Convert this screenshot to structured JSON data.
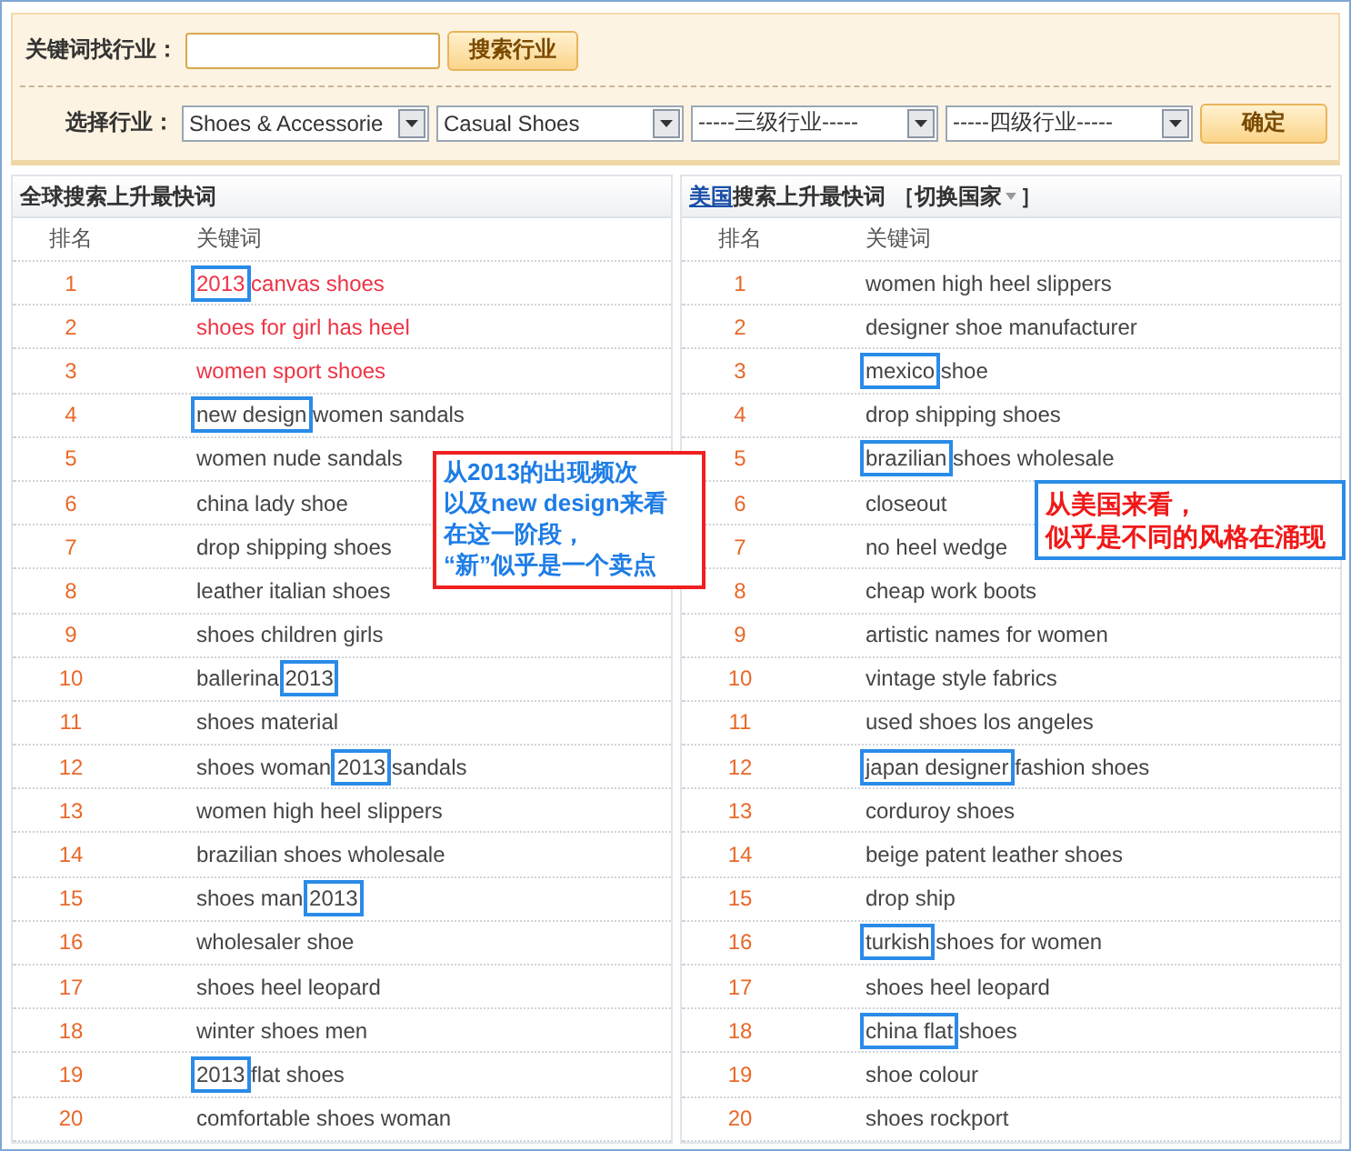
{
  "search": {
    "label": "关键词找行业：",
    "button": "搜索行业"
  },
  "industry": {
    "label": "选择行业：",
    "selects": [
      "Shoes & Accessorie",
      "Casual Shoes",
      "-----三级行业-----",
      "-----四级行业-----"
    ],
    "button": "确定"
  },
  "global_panel": {
    "title": "全球搜索上升最快词",
    "columns": [
      "排名",
      "关键词"
    ],
    "rows": [
      {
        "rank": "1",
        "hot": true,
        "parts": [
          {
            "text": "2013",
            "boxed": true
          },
          {
            "text": " canvas shoes",
            "boxed": false
          }
        ]
      },
      {
        "rank": "2",
        "hot": true,
        "parts": [
          {
            "text": "shoes for girl has heel",
            "boxed": false
          }
        ]
      },
      {
        "rank": "3",
        "hot": true,
        "parts": [
          {
            "text": "women sport shoes",
            "boxed": false
          }
        ]
      },
      {
        "rank": "4",
        "hot": false,
        "parts": [
          {
            "text": "new design",
            "boxed": true
          },
          {
            "text": " women sandals",
            "boxed": false
          }
        ]
      },
      {
        "rank": "5",
        "hot": false,
        "parts": [
          {
            "text": "women nude sandals",
            "boxed": false
          }
        ]
      },
      {
        "rank": "6",
        "hot": false,
        "parts": [
          {
            "text": "china lady shoe",
            "boxed": false
          }
        ]
      },
      {
        "rank": "7",
        "hot": false,
        "parts": [
          {
            "text": "drop shipping shoes",
            "boxed": false
          }
        ]
      },
      {
        "rank": "8",
        "hot": false,
        "parts": [
          {
            "text": "leather italian shoes",
            "boxed": false
          }
        ]
      },
      {
        "rank": "9",
        "hot": false,
        "parts": [
          {
            "text": "shoes children girls",
            "boxed": false
          }
        ]
      },
      {
        "rank": "10",
        "hot": false,
        "parts": [
          {
            "text": "ballerina ",
            "boxed": false
          },
          {
            "text": "2013",
            "boxed": true
          }
        ]
      },
      {
        "rank": "11",
        "hot": false,
        "parts": [
          {
            "text": "shoes material",
            "boxed": false
          }
        ]
      },
      {
        "rank": "12",
        "hot": false,
        "parts": [
          {
            "text": "shoes woman ",
            "boxed": false
          },
          {
            "text": "2013",
            "boxed": true
          },
          {
            "text": " sandals",
            "boxed": false
          }
        ]
      },
      {
        "rank": "13",
        "hot": false,
        "parts": [
          {
            "text": "women high heel slippers",
            "boxed": false
          }
        ]
      },
      {
        "rank": "14",
        "hot": false,
        "parts": [
          {
            "text": "brazilian shoes wholesale",
            "boxed": false
          }
        ]
      },
      {
        "rank": "15",
        "hot": false,
        "parts": [
          {
            "text": "shoes man ",
            "boxed": false
          },
          {
            "text": "2013",
            "boxed": true
          }
        ]
      },
      {
        "rank": "16",
        "hot": false,
        "parts": [
          {
            "text": "wholesaler shoe",
            "boxed": false
          }
        ]
      },
      {
        "rank": "17",
        "hot": false,
        "parts": [
          {
            "text": "shoes heel leopard",
            "boxed": false
          }
        ]
      },
      {
        "rank": "18",
        "hot": false,
        "parts": [
          {
            "text": "winter shoes men",
            "boxed": false
          }
        ]
      },
      {
        "rank": "19",
        "hot": false,
        "parts": [
          {
            "text": "2013",
            "boxed": true
          },
          {
            "text": " flat shoes",
            "boxed": false
          }
        ]
      },
      {
        "rank": "20",
        "hot": false,
        "parts": [
          {
            "text": "comfortable shoes woman",
            "boxed": false
          }
        ]
      }
    ]
  },
  "country_panel": {
    "country": "美国",
    "title": "搜索上升最快词",
    "switch": {
      "label": "［切换国家",
      "end": "］",
      "expanded": false
    },
    "columns": [
      "排名",
      "关键词"
    ],
    "rows": [
      {
        "rank": "1",
        "hot": false,
        "parts": [
          {
            "text": "women high heel slippers",
            "boxed": false
          }
        ]
      },
      {
        "rank": "2",
        "hot": false,
        "parts": [
          {
            "text": "designer shoe manufacturer",
            "boxed": false
          }
        ]
      },
      {
        "rank": "3",
        "hot": false,
        "parts": [
          {
            "text": "mexico",
            "boxed": true
          },
          {
            "text": " shoe",
            "boxed": false
          }
        ]
      },
      {
        "rank": "4",
        "hot": false,
        "parts": [
          {
            "text": "drop shipping shoes",
            "boxed": false
          }
        ]
      },
      {
        "rank": "5",
        "hot": false,
        "parts": [
          {
            "text": "brazilian",
            "boxed": true
          },
          {
            "text": " shoes wholesale",
            "boxed": false
          }
        ]
      },
      {
        "rank": "6",
        "hot": false,
        "parts": [
          {
            "text": "closeout",
            "boxed": false
          }
        ]
      },
      {
        "rank": "7",
        "hot": false,
        "parts": [
          {
            "text": "no heel wedge",
            "boxed": false
          }
        ]
      },
      {
        "rank": "8",
        "hot": false,
        "parts": [
          {
            "text": "cheap work boots",
            "boxed": false
          }
        ]
      },
      {
        "rank": "9",
        "hot": false,
        "parts": [
          {
            "text": "artistic names for women",
            "boxed": false
          }
        ]
      },
      {
        "rank": "10",
        "hot": false,
        "parts": [
          {
            "text": "vintage style fabrics",
            "boxed": false
          }
        ]
      },
      {
        "rank": "11",
        "hot": false,
        "parts": [
          {
            "text": "used shoes los angeles",
            "boxed": false
          }
        ]
      },
      {
        "rank": "12",
        "hot": false,
        "parts": [
          {
            "text": "japan designer",
            "boxed": true
          },
          {
            "text": " fashion shoes",
            "boxed": false
          }
        ]
      },
      {
        "rank": "13",
        "hot": false,
        "parts": [
          {
            "text": "corduroy shoes",
            "boxed": false
          }
        ]
      },
      {
        "rank": "14",
        "hot": false,
        "parts": [
          {
            "text": "beige patent leather shoes",
            "boxed": false
          }
        ]
      },
      {
        "rank": "15",
        "hot": false,
        "parts": [
          {
            "text": "drop ship",
            "boxed": false
          }
        ]
      },
      {
        "rank": "16",
        "hot": false,
        "parts": [
          {
            "text": "turkish",
            "boxed": true
          },
          {
            "text": " shoes for women",
            "boxed": false
          }
        ]
      },
      {
        "rank": "17",
        "hot": false,
        "parts": [
          {
            "text": "shoes heel leopard",
            "boxed": false
          }
        ]
      },
      {
        "rank": "18",
        "hot": false,
        "parts": [
          {
            "text": "china flat",
            "boxed": true
          },
          {
            "text": " shoes",
            "boxed": false
          }
        ]
      },
      {
        "rank": "19",
        "hot": false,
        "parts": [
          {
            "text": "shoe colour",
            "boxed": false
          }
        ]
      },
      {
        "rank": "20",
        "hot": false,
        "parts": [
          {
            "text": "shoes rockport",
            "boxed": false
          }
        ]
      }
    ]
  },
  "notes": [
    {
      "kind": "global",
      "lines": [
        "从2013的出现频次",
        "以及new design来看",
        "在这一阶段，",
        "“新”似乎是一个卖点"
      ],
      "color": "#1e7de6"
    },
    {
      "kind": "country",
      "lines": [
        "从美国来看，",
        "似乎是不同的风格在涌现"
      ],
      "color": "#f01818"
    }
  ]
}
